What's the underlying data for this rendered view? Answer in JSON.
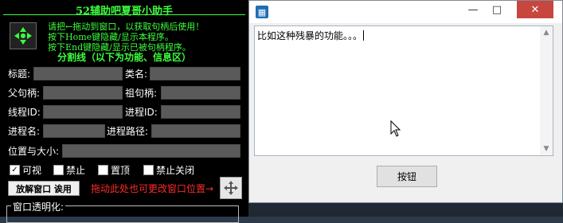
{
  "helper": {
    "title": "52辅助吧夏哥小助手",
    "instructions": [
      "请把←拖动到窗口，以获取句柄后使用！",
      "按下Home键隐藏/显示本程序。",
      "按下End键隐藏/显示已被句柄程序。"
    ],
    "divider": "分割线（以下为功能、信息区）",
    "fields": {
      "title_label": "标题:",
      "class_label": "类名:",
      "parent_label": "父句柄:",
      "grandparent_label": "祖句柄:",
      "thread_label": "线程ID:",
      "process_label": "进程ID:",
      "pname_label": "进程名:",
      "ppath_label": "进程路径:",
      "pos_label": "位置与大小:"
    },
    "checks": [
      {
        "label": "可视",
        "checked": true
      },
      {
        "label": "禁止",
        "checked": false
      },
      {
        "label": "置顶",
        "checked": false
      },
      {
        "label": "禁止关闭",
        "checked": false
      }
    ],
    "hide_button": "放解窗口  诶用",
    "move_hint": "拖动此处也可更改窗口位置→",
    "opacity_label": "窗口透明化:"
  },
  "window": {
    "editor_text": "比如这种残暴的功能。。。",
    "button": "按钮"
  },
  "colors": {
    "helper_text": "#3cff3c",
    "hint": "#ff2a2a",
    "close": "#c7473e"
  }
}
